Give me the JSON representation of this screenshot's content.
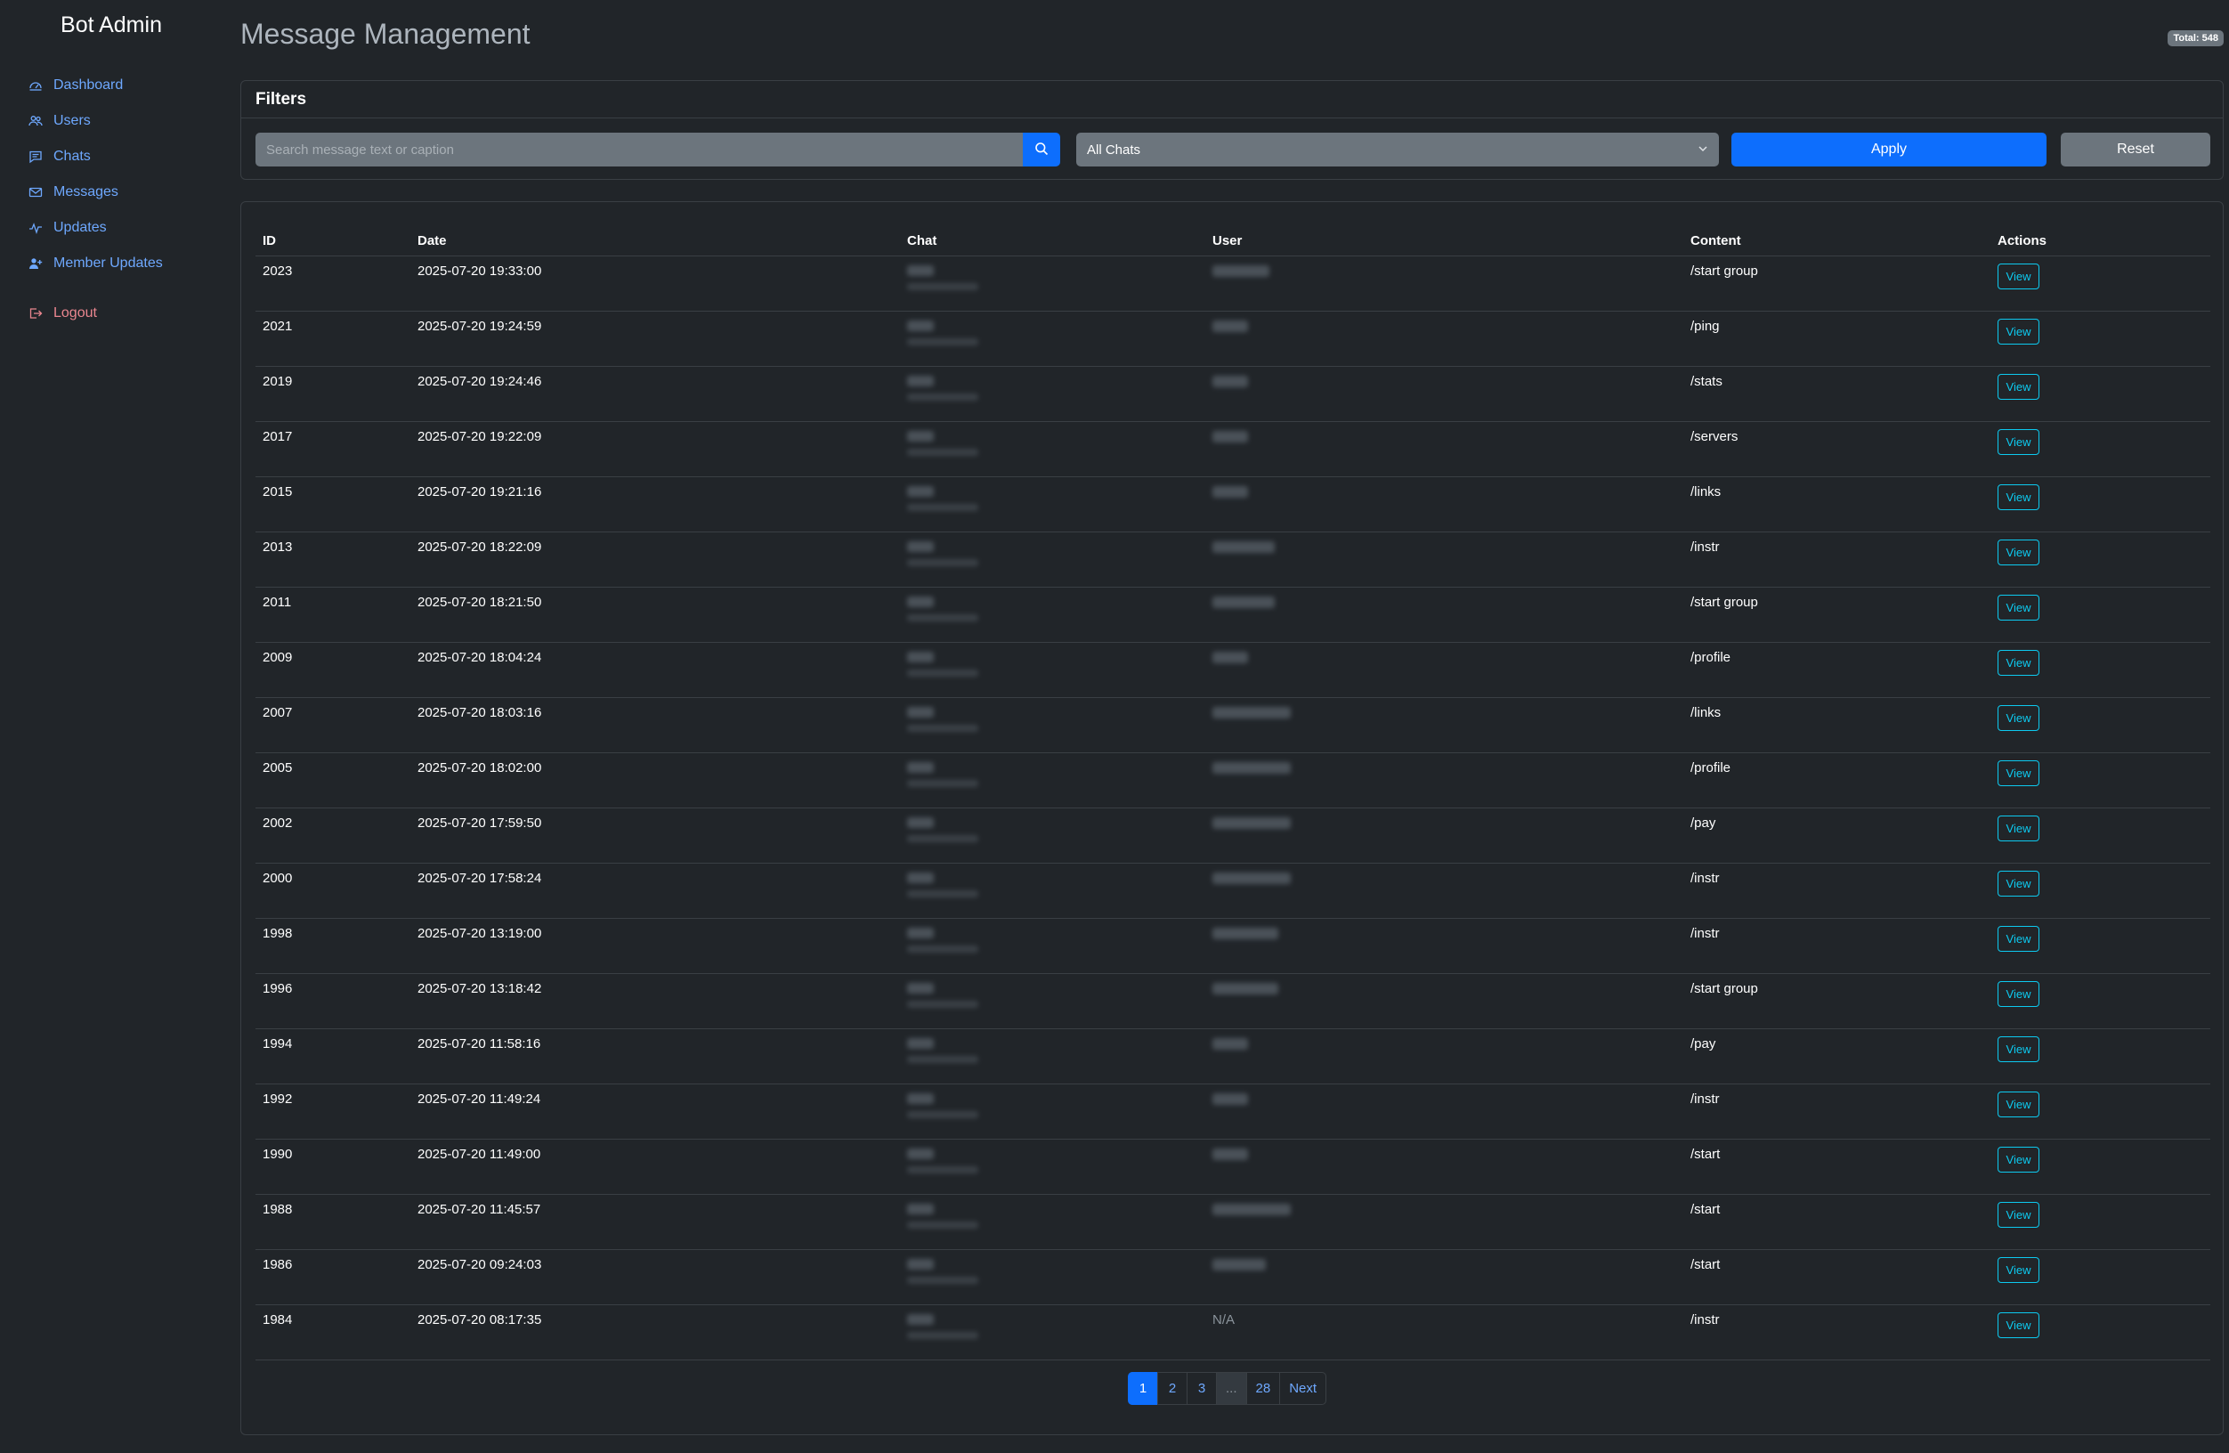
{
  "sidebar": {
    "brand": "Bot Admin",
    "items": [
      {
        "label": "Dashboard",
        "icon": "speedometer-icon"
      },
      {
        "label": "Users",
        "icon": "people-icon"
      },
      {
        "label": "Chats",
        "icon": "chat-icon"
      },
      {
        "label": "Messages",
        "icon": "envelope-icon"
      },
      {
        "label": "Updates",
        "icon": "activity-icon"
      },
      {
        "label": "Member Updates",
        "icon": "person-plus-icon"
      }
    ],
    "logout": "Logout"
  },
  "header": {
    "title": "Message Management",
    "total_badge": "Total: 548"
  },
  "filters": {
    "title": "Filters",
    "search_placeholder": "Search message text or caption",
    "search_value": "",
    "chat_select": "All Chats",
    "apply": "Apply",
    "reset": "Reset"
  },
  "table": {
    "columns": [
      "ID",
      "Date",
      "Chat",
      "User",
      "Content",
      "Actions"
    ],
    "view_label": "View",
    "rows": [
      {
        "id": "2023",
        "date": "2025-07-20 19:33:00",
        "user": "",
        "content": "/start group"
      },
      {
        "id": "2021",
        "date": "2025-07-20 19:24:59",
        "user": "",
        "content": "/ping"
      },
      {
        "id": "2019",
        "date": "2025-07-20 19:24:46",
        "user": "",
        "content": "/stats"
      },
      {
        "id": "2017",
        "date": "2025-07-20 19:22:09",
        "user": "",
        "content": "/servers"
      },
      {
        "id": "2015",
        "date": "2025-07-20 19:21:16",
        "user": "",
        "content": "/links"
      },
      {
        "id": "2013",
        "date": "2025-07-20 18:22:09",
        "user": "",
        "content": "/instr"
      },
      {
        "id": "2011",
        "date": "2025-07-20 18:21:50",
        "user": "",
        "content": "/start group"
      },
      {
        "id": "2009",
        "date": "2025-07-20 18:04:24",
        "user": "",
        "content": "/profile"
      },
      {
        "id": "2007",
        "date": "2025-07-20 18:03:16",
        "user": "",
        "content": "/links"
      },
      {
        "id": "2005",
        "date": "2025-07-20 18:02:00",
        "user": "",
        "content": "/profile"
      },
      {
        "id": "2002",
        "date": "2025-07-20 17:59:50",
        "user": "",
        "content": "/pay"
      },
      {
        "id": "2000",
        "date": "2025-07-20 17:58:24",
        "user": "",
        "content": "/instr"
      },
      {
        "id": "1998",
        "date": "2025-07-20 13:19:00",
        "user": "",
        "content": "/instr"
      },
      {
        "id": "1996",
        "date": "2025-07-20 13:18:42",
        "user": "",
        "content": "/start group"
      },
      {
        "id": "1994",
        "date": "2025-07-20 11:58:16",
        "user": "",
        "content": "/pay"
      },
      {
        "id": "1992",
        "date": "2025-07-20 11:49:24",
        "user": "",
        "content": "/instr"
      },
      {
        "id": "1990",
        "date": "2025-07-20 11:49:00",
        "user": "",
        "content": "/start"
      },
      {
        "id": "1988",
        "date": "2025-07-20 11:45:57",
        "user": "",
        "content": "/start"
      },
      {
        "id": "1986",
        "date": "2025-07-20 09:24:03",
        "user": "",
        "content": "/start"
      },
      {
        "id": "1984",
        "date": "2025-07-20 08:17:35",
        "user": "N/A",
        "content": "/instr"
      }
    ]
  },
  "pagination": {
    "pages": [
      "1",
      "2",
      "3",
      "...",
      "28"
    ],
    "active": "1",
    "next": "Next"
  },
  "colors": {
    "background": "#212529",
    "primary": "#0d6efd",
    "link": "#6ea8fe",
    "info": "#0dcaf0",
    "danger": "#ea868f",
    "secondary": "#6c757d"
  }
}
